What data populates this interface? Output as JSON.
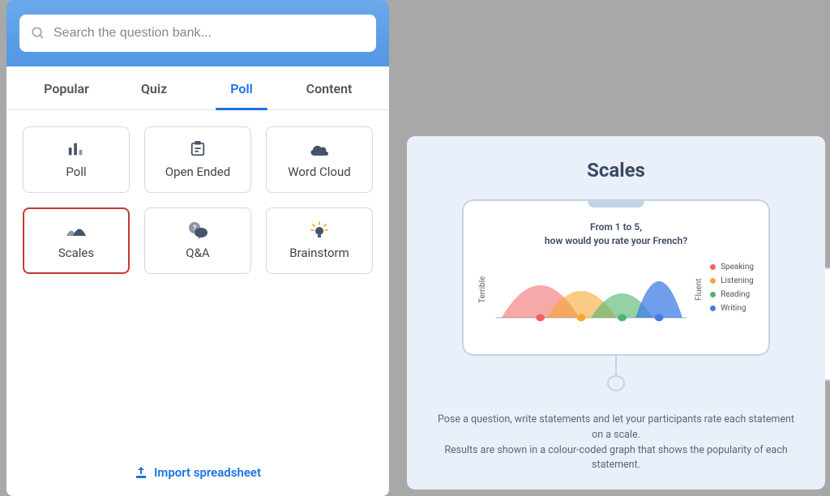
{
  "search": {
    "placeholder": "Search the question bank..."
  },
  "tabs": [
    {
      "label": "Popular",
      "active": false
    },
    {
      "label": "Quiz",
      "active": false
    },
    {
      "label": "Poll",
      "active": true
    },
    {
      "label": "Content",
      "active": false
    }
  ],
  "cards": [
    {
      "label": "Poll",
      "icon": "bar-chart-icon",
      "selected": false
    },
    {
      "label": "Open Ended",
      "icon": "clipboard-icon",
      "selected": false
    },
    {
      "label": "Word Cloud",
      "icon": "cloud-icon",
      "selected": false
    },
    {
      "label": "Scales",
      "icon": "mountain-icon",
      "selected": true
    },
    {
      "label": "Q&A",
      "icon": "qa-icon",
      "selected": false
    },
    {
      "label": "Brainstorm",
      "icon": "bulb-icon",
      "selected": false
    }
  ],
  "import_link": "Import spreadsheet",
  "preview": {
    "title": "Scales",
    "question_line1": "From 1 to 5,",
    "question_line2": "how would you rate your French?",
    "axis_low": "Terrible",
    "axis_high": "Fluent",
    "legend": [
      {
        "label": "Speaking",
        "color": "#f06262"
      },
      {
        "label": "Listening",
        "color": "#f5a933"
      },
      {
        "label": "Reading",
        "color": "#4fb36d"
      },
      {
        "label": "Writing",
        "color": "#3f7ee6"
      }
    ],
    "description_line1": "Pose a question, write statements and let your participants rate each statement on a scale.",
    "description_line2": "Results are shown in a colour-coded graph that shows the popularity of each statement."
  },
  "chart_data": {
    "type": "area",
    "title": "From 1 to 5, how would you rate your French?",
    "xlabel": "",
    "x_endpoints": [
      "Terrible",
      "Fluent"
    ],
    "xlim": [
      1,
      5
    ],
    "series": [
      {
        "name": "Speaking",
        "peak_x": 2.0,
        "spread": 1.2,
        "color": "#f06262"
      },
      {
        "name": "Listening",
        "peak_x": 2.8,
        "spread": 1.0,
        "color": "#f5a933"
      },
      {
        "name": "Reading",
        "peak_x": 3.6,
        "spread": 1.0,
        "color": "#4fb36d"
      },
      {
        "name": "Writing",
        "peak_x": 4.3,
        "spread": 0.8,
        "color": "#3f7ee6"
      }
    ]
  }
}
